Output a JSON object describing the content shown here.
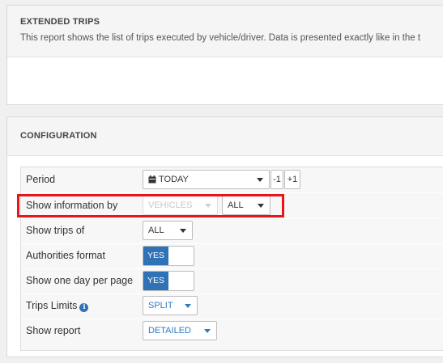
{
  "extended_trips": {
    "title": "EXTENDED TRIPS",
    "description": "This report shows the list of trips executed by vehicle/driver. Data is presented exactly like in the t"
  },
  "configuration": {
    "title": "CONFIGURATION",
    "rows": {
      "period": {
        "label": "Period",
        "value": "TODAY",
        "prev": "-1",
        "next": "+1",
        "icon": "calendar-icon"
      },
      "show_information_by": {
        "label": "Show information by",
        "type_value": "VEHICLES",
        "scope_value": "ALL"
      },
      "show_trips_of": {
        "label": "Show trips of",
        "value": "ALL"
      },
      "authorities_format": {
        "label": "Authorities format",
        "value": "YES"
      },
      "show_one_day_per_page": {
        "label": "Show one day per page",
        "value": "YES"
      },
      "trips_limits": {
        "label": "Trips Limits",
        "value": "SPLIT",
        "icon": "info-icon"
      },
      "show_report": {
        "label": "Show report",
        "value": "DETAILED"
      }
    }
  },
  "colors": {
    "accent": "#2f72b6",
    "highlight": "#e8141a"
  }
}
